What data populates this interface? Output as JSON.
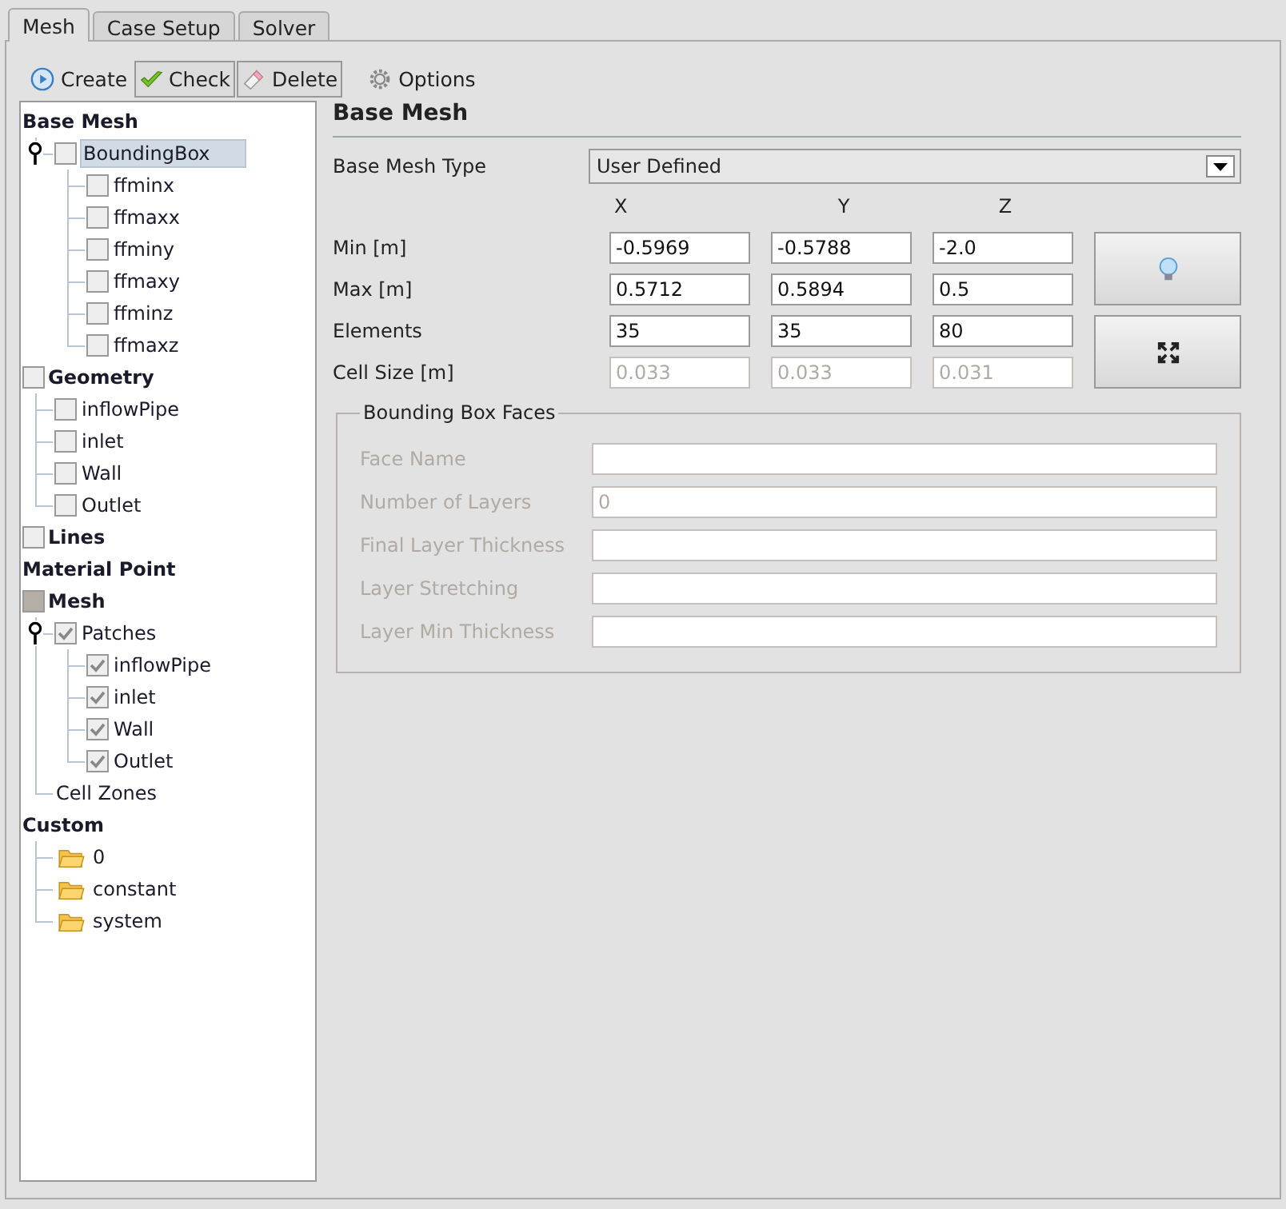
{
  "tabs": [
    {
      "label": "Mesh",
      "selected": true
    },
    {
      "label": "Case Setup",
      "selected": false
    },
    {
      "label": "Solver",
      "selected": false
    }
  ],
  "toolbar": [
    {
      "label": "Create",
      "kind": "create"
    },
    {
      "label": "Check",
      "kind": "check"
    },
    {
      "label": "Delete",
      "kind": "delete"
    },
    {
      "label": "Options",
      "kind": "options"
    }
  ],
  "tree": [
    {
      "label": "Base Mesh",
      "kind": "section",
      "selected": false,
      "children": [
        {
          "label": "BoundingBox",
          "kind": "check",
          "checked": false,
          "partial": false,
          "selected": true,
          "expanded": true,
          "children": [
            {
              "label": "ffminx",
              "kind": "check",
              "checked": false,
              "partial": false,
              "selected": false
            },
            {
              "label": "ffmaxx",
              "kind": "check",
              "checked": false,
              "partial": false,
              "selected": false
            },
            {
              "label": "ffminy",
              "kind": "check",
              "checked": false,
              "partial": false,
              "selected": false
            },
            {
              "label": "ffmaxy",
              "kind": "check",
              "checked": false,
              "partial": false,
              "selected": false
            },
            {
              "label": "ffminz",
              "kind": "check",
              "checked": false,
              "partial": false,
              "selected": false
            },
            {
              "label": "ffmaxz",
              "kind": "check",
              "checked": false,
              "partial": false,
              "selected": false
            }
          ]
        }
      ]
    },
    {
      "label": "Geometry",
      "kind": "section-check",
      "checked": false,
      "partial": false,
      "selected": false,
      "children": [
        {
          "label": "inflowPipe",
          "kind": "check",
          "checked": false,
          "partial": false,
          "selected": false
        },
        {
          "label": "inlet",
          "kind": "check",
          "checked": false,
          "partial": false,
          "selected": false
        },
        {
          "label": "Wall",
          "kind": "check",
          "checked": false,
          "partial": false,
          "selected": false
        },
        {
          "label": "Outlet",
          "kind": "check",
          "checked": false,
          "partial": false,
          "selected": false
        }
      ]
    },
    {
      "label": "Lines",
      "kind": "section-check",
      "checked": false,
      "partial": false,
      "selected": false
    },
    {
      "label": "Material Point",
      "kind": "section",
      "selected": false
    },
    {
      "label": "Mesh",
      "kind": "section-check",
      "checked": false,
      "partial": true,
      "selected": false,
      "children": [
        {
          "label": "Patches",
          "kind": "check",
          "checked": true,
          "partial": false,
          "selected": false,
          "expanded": true,
          "children": [
            {
              "label": "inflowPipe",
              "kind": "check",
              "checked": true,
              "partial": false,
              "selected": false
            },
            {
              "label": "inlet",
              "kind": "check",
              "checked": true,
              "partial": false,
              "selected": false
            },
            {
              "label": "Wall",
              "kind": "check",
              "checked": true,
              "partial": false,
              "selected": false
            },
            {
              "label": "Outlet",
              "kind": "check",
              "checked": true,
              "partial": false,
              "selected": false
            }
          ]
        },
        {
          "label": "Cell Zones",
          "kind": "plain",
          "selected": false
        }
      ]
    },
    {
      "label": "Custom",
      "kind": "section",
      "selected": false,
      "children": [
        {
          "label": "0",
          "kind": "folder",
          "selected": false
        },
        {
          "label": "constant",
          "kind": "folder",
          "selected": false
        },
        {
          "label": "system",
          "kind": "folder",
          "selected": false
        }
      ]
    }
  ],
  "form": {
    "title": "Base Mesh",
    "type_label": "Base Mesh Type",
    "type_value": "User Defined",
    "axes": [
      "X",
      "Y",
      "Z"
    ],
    "rows": [
      {
        "label": "Min [m]",
        "values": [
          "-0.5969",
          "-0.5788",
          "-2.0"
        ],
        "disabled": false
      },
      {
        "label": "Max [m]",
        "values": [
          "0.5712",
          "0.5894",
          "0.5"
        ],
        "disabled": false
      },
      {
        "label": "Elements",
        "values": [
          "35",
          "35",
          "80"
        ],
        "disabled": false
      },
      {
        "label": "Cell Size [m]",
        "values": [
          "0.033",
          "0.033",
          "0.031"
        ],
        "disabled": true
      }
    ],
    "buttons": [
      {
        "kind": "bulb"
      },
      {
        "kind": "fit"
      }
    ]
  },
  "faces": {
    "title": "Bounding Box Faces",
    "fields": [
      {
        "label": "Face Name",
        "disabled": true
      },
      {
        "label": "Number of Layers",
        "value": "0",
        "disabled": true
      },
      {
        "label": "Final Layer Thickness",
        "disabled": true
      },
      {
        "label": "Layer Stretching",
        "disabled": true
      },
      {
        "label": "Layer Min Thickness",
        "disabled": true
      }
    ]
  }
}
